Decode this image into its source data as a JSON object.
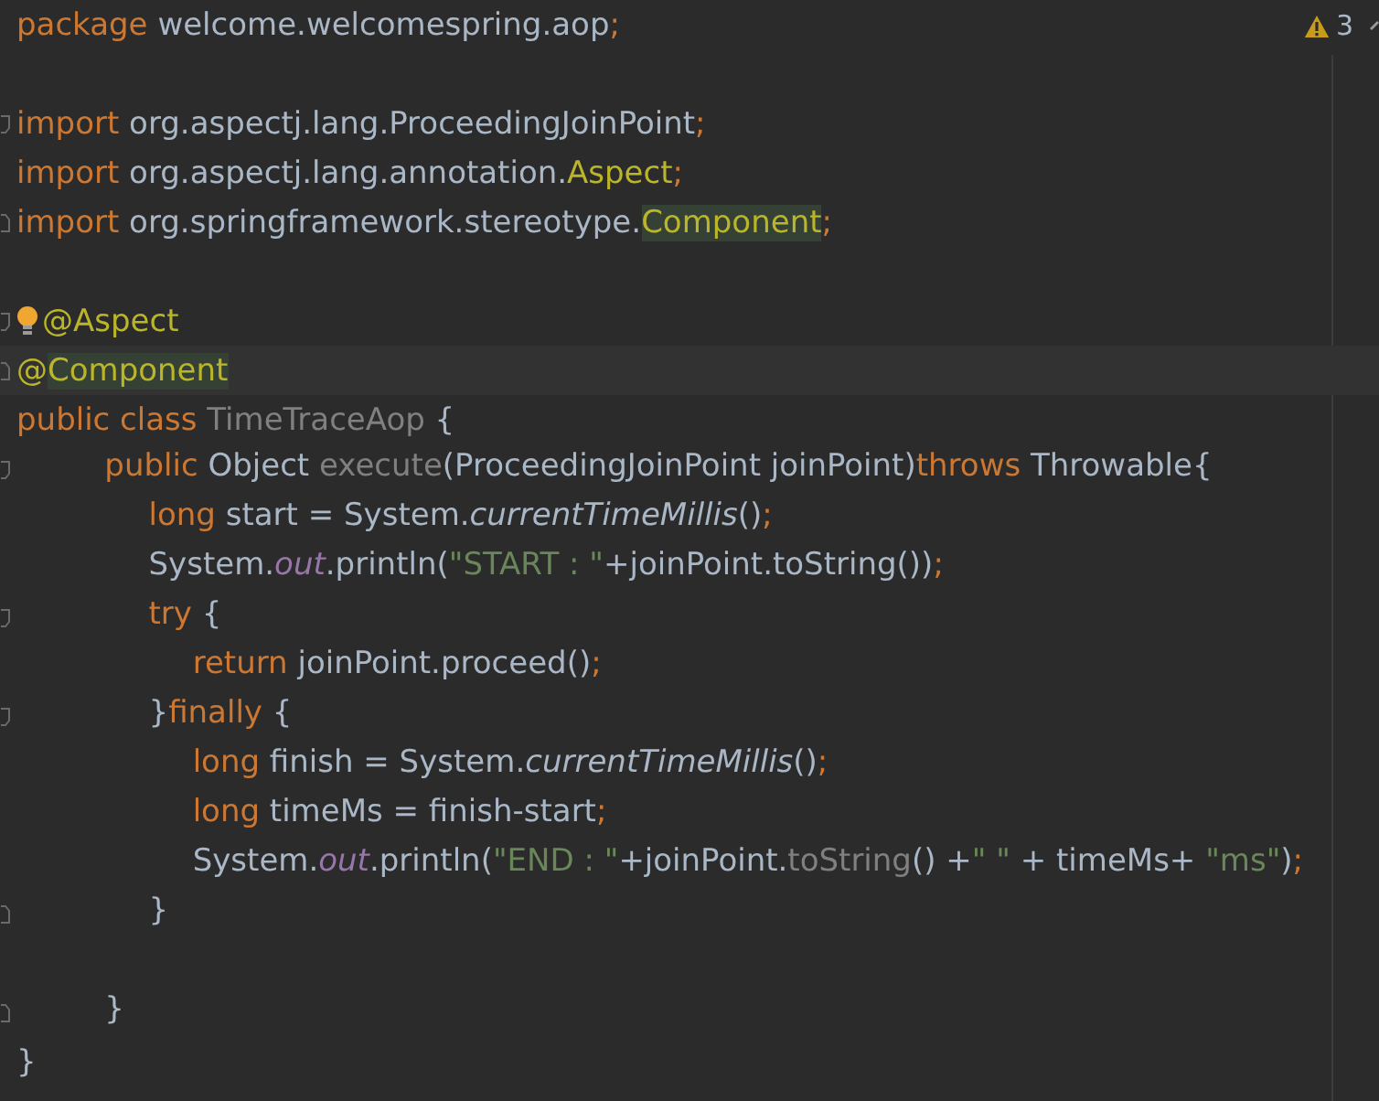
{
  "editor": {
    "warning_count": "3",
    "lines": [
      {
        "tokens": [
          {
            "kind": "keyword",
            "text": "package "
          },
          {
            "kind": "plain",
            "text": "welcome.welcomespring.aop"
          },
          {
            "kind": "keyword",
            "text": ";"
          }
        ]
      },
      {
        "kind": "blank"
      },
      {
        "fold_marker": {
          "kind": "start"
        },
        "tokens": [
          {
            "kind": "keyword",
            "text": "import "
          },
          {
            "kind": "plain",
            "text": "org.aspectj.lang.ProceedingJoinPoint"
          },
          {
            "kind": "keyword",
            "text": ";"
          }
        ]
      },
      {
        "tokens": [
          {
            "kind": "keyword",
            "text": "import "
          },
          {
            "kind": "plain",
            "text": "org.aspectj.lang.annotation."
          },
          {
            "kind": "annotation",
            "text": "Aspect"
          },
          {
            "kind": "keyword",
            "text": ";"
          }
        ]
      },
      {
        "fold_marker": {
          "kind": "end"
        },
        "tokens": [
          {
            "kind": "keyword",
            "text": "import "
          },
          {
            "kind": "plain",
            "text": "org.springframework.stereotype."
          },
          {
            "kind": "match",
            "text": "Component"
          },
          {
            "kind": "keyword",
            "text": ";"
          }
        ]
      },
      {
        "kind": "blank"
      },
      {
        "intention": true,
        "fold_marker": {
          "kind": "start"
        },
        "tokens": [
          {
            "kind": "annotation",
            "text": "@Aspect"
          }
        ]
      },
      {
        "current": true,
        "fold_marker": {
          "kind": "end"
        },
        "tokens": [
          {
            "kind": "annotation",
            "text": "@"
          },
          {
            "kind": "match",
            "text": "Component"
          }
        ]
      },
      {
        "tokens": [
          {
            "kind": "keyword",
            "text": "public class "
          },
          {
            "kind": "unused",
            "text": "TimeTraceAop"
          },
          {
            "kind": "plain",
            "text": " {"
          }
        ]
      },
      {
        "fold_marker": {
          "kind": "start"
        },
        "tokens": [
          {
            "kind": "keyword",
            "text": "        public "
          },
          {
            "kind": "plain",
            "text": "Object "
          },
          {
            "kind": "unused",
            "text": "execute"
          },
          {
            "kind": "plain",
            "text": "(ProceedingJoinPoint joinPoint)"
          },
          {
            "kind": "keyword",
            "text": "throws "
          },
          {
            "kind": "plain",
            "text": "Throwable{"
          }
        ]
      },
      {
        "tokens": [
          {
            "kind": "keyword",
            "text": "            long "
          },
          {
            "kind": "plain",
            "text": "start = System."
          },
          {
            "kind": "call",
            "text": "currentTimeMillis"
          },
          {
            "kind": "plain",
            "text": "()"
          },
          {
            "kind": "keyword",
            "text": ";"
          }
        ]
      },
      {
        "tokens": [
          {
            "kind": "plain",
            "text": "            System."
          },
          {
            "kind": "field",
            "text": "out"
          },
          {
            "kind": "plain",
            "text": ".println("
          },
          {
            "kind": "string",
            "text": "\"START : \""
          },
          {
            "kind": "plain",
            "text": "+joinPoint.toString())"
          },
          {
            "kind": "keyword",
            "text": ";"
          }
        ]
      },
      {
        "fold_marker": {
          "kind": "start"
        },
        "tokens": [
          {
            "kind": "keyword",
            "text": "            try "
          },
          {
            "kind": "plain",
            "text": "{"
          }
        ]
      },
      {
        "tokens": [
          {
            "kind": "keyword",
            "text": "                return "
          },
          {
            "kind": "plain",
            "text": "joinPoint.proceed()"
          },
          {
            "kind": "keyword",
            "text": ";"
          }
        ]
      },
      {
        "fold_marker": {
          "kind": "start"
        },
        "tokens": [
          {
            "kind": "plain",
            "text": "            }"
          },
          {
            "kind": "keyword",
            "text": "finally "
          },
          {
            "kind": "plain",
            "text": "{"
          }
        ]
      },
      {
        "tokens": [
          {
            "kind": "keyword",
            "text": "                long "
          },
          {
            "kind": "plain",
            "text": "finish = System."
          },
          {
            "kind": "call",
            "text": "currentTimeMillis"
          },
          {
            "kind": "plain",
            "text": "()"
          },
          {
            "kind": "keyword",
            "text": ";"
          }
        ]
      },
      {
        "tokens": [
          {
            "kind": "keyword",
            "text": "                long "
          },
          {
            "kind": "plain",
            "text": "timeMs = finish-start"
          },
          {
            "kind": "keyword",
            "text": ";"
          }
        ]
      },
      {
        "tokens": [
          {
            "kind": "plain",
            "text": "                System."
          },
          {
            "kind": "field",
            "text": "out"
          },
          {
            "kind": "plain",
            "text": ".println("
          },
          {
            "kind": "string",
            "text": "\"END : \""
          },
          {
            "kind": "plain",
            "text": "+joinPoint."
          },
          {
            "kind": "unused",
            "text": "toString"
          },
          {
            "kind": "plain",
            "text": "() +"
          },
          {
            "kind": "string",
            "text": "\" \""
          },
          {
            "kind": "plain",
            "text": " + timeMs+ "
          },
          {
            "kind": "string",
            "text": "\"ms\""
          },
          {
            "kind": "plain",
            "text": ")"
          },
          {
            "kind": "keyword",
            "text": ";"
          }
        ]
      },
      {
        "fold_marker": {
          "kind": "end"
        },
        "tokens": [
          {
            "kind": "plain",
            "text": "            }"
          }
        ]
      },
      {
        "kind": "blank"
      },
      {
        "fold_marker": {
          "kind": "end"
        },
        "tokens": [
          {
            "kind": "plain",
            "text": "        }"
          }
        ]
      },
      {
        "tokens": [
          {
            "kind": "plain",
            "text": "}"
          }
        ]
      }
    ]
  }
}
